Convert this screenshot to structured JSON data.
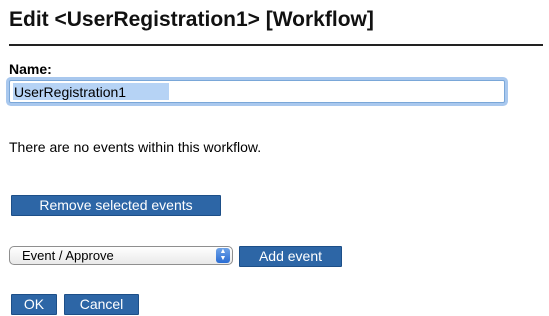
{
  "page": {
    "title": "Edit <UserRegistration1> [Workflow]"
  },
  "form": {
    "name_label": "Name:",
    "name_value": "UserRegistration1"
  },
  "events": {
    "empty_message": "There are no events within this workflow.",
    "remove_button": "Remove selected events",
    "event_type_selected": "Event / Approve",
    "add_button": "Add event"
  },
  "actions": {
    "ok_button": "OK",
    "cancel_button": "Cancel"
  },
  "colors": {
    "button_bg": "#2d66a6",
    "focus_ring": "#a9c8ee"
  }
}
